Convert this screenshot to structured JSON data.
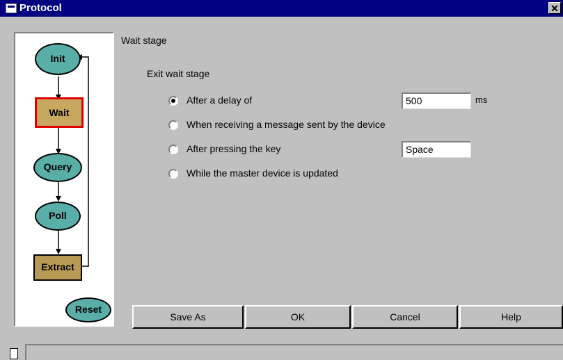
{
  "window": {
    "title": "Protocol",
    "close_symbol": "✕"
  },
  "flow": {
    "nodes": [
      {
        "label": "Init",
        "shape": "oval"
      },
      {
        "label": "Wait",
        "shape": "rect",
        "active": true
      },
      {
        "label": "Query",
        "shape": "oval"
      },
      {
        "label": "Poll",
        "shape": "oval"
      },
      {
        "label": "Extract",
        "shape": "rect"
      },
      {
        "label": "Reset",
        "shape": "oval"
      }
    ]
  },
  "stage": {
    "title": "Wait stage",
    "group_label": "Exit wait stage",
    "options": [
      {
        "label": "After a delay of",
        "checked": true
      },
      {
        "label": "When receiving a message sent by the device",
        "checked": false
      },
      {
        "label": "After pressing the key",
        "checked": false
      },
      {
        "label": "While the master device is updated",
        "checked": false
      }
    ],
    "delay_value": "500",
    "delay_unit": "ms",
    "key_value": "Space"
  },
  "buttons": {
    "save_as": "Save As",
    "ok": "OK",
    "cancel": "Cancel",
    "help": "Help"
  },
  "colors": {
    "titlebar": "#000080",
    "dialog": "#c0c0c0",
    "node_oval": "#5aaea8",
    "node_rect": "#b89a55",
    "active_border": "#e00000"
  }
}
